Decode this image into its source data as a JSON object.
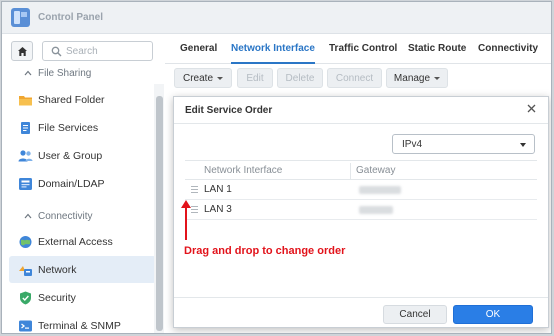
{
  "window": {
    "title": "Control Panel"
  },
  "sidebar": {
    "search_placeholder": "Search",
    "sections": [
      {
        "label": "File Sharing",
        "icon": "chevron-up-icon"
      },
      {
        "label": "Connectivity",
        "icon": "chevron-up-icon"
      }
    ],
    "items": [
      {
        "label": "Shared Folder",
        "icon": "folder-icon"
      },
      {
        "label": "File Services",
        "icon": "file-services-icon"
      },
      {
        "label": "User & Group",
        "icon": "users-icon"
      },
      {
        "label": "Domain/LDAP",
        "icon": "domain-icon"
      },
      {
        "label": "External Access",
        "icon": "globe-icon"
      },
      {
        "label": "Network",
        "icon": "network-icon",
        "active": true
      },
      {
        "label": "Security",
        "icon": "shield-icon"
      },
      {
        "label": "Terminal & SNMP",
        "icon": "terminal-icon"
      }
    ]
  },
  "tabs": [
    {
      "label": "General"
    },
    {
      "label": "Network Interface",
      "active": true
    },
    {
      "label": "Traffic Control"
    },
    {
      "label": "Static Route"
    },
    {
      "label": "Connectivity"
    }
  ],
  "toolbar": {
    "create": "Create",
    "edit": "Edit",
    "delete": "Delete",
    "connect": "Connect",
    "manage": "Manage"
  },
  "dialog": {
    "title": "Edit Service Order",
    "protocol_selected": "IPv4",
    "columns": [
      "Network Interface",
      "Gateway"
    ],
    "rows": [
      {
        "interface": "LAN 1"
      },
      {
        "interface": "LAN 3"
      }
    ],
    "annotation": "Drag and drop to change order",
    "cancel": "Cancel",
    "ok": "OK"
  },
  "colors": {
    "accent": "#2a76c6",
    "ok_button": "#2a7ee6",
    "annotation": "#e2131b"
  }
}
